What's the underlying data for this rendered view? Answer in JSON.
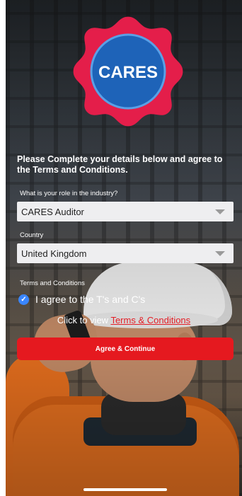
{
  "brand": {
    "name": "CARES",
    "badge_color": "#e41e4a",
    "circle_color": "#1e63b8"
  },
  "heading": "Please Complete your details below and agree to the Terms and Conditions.",
  "role": {
    "label": "What is your role in the industry?",
    "value": "CARES Auditor"
  },
  "country": {
    "label": "Country",
    "value": "United Kingdom"
  },
  "terms": {
    "section_label": "Terms and Conditions",
    "checkbox_label": "I agree to the T's and C's",
    "checked": true,
    "view_prefix": "Click to view ",
    "view_link": "Terms & Conditions"
  },
  "actions": {
    "agree_label": "Agree & Continue",
    "accent": "#e5191f"
  }
}
